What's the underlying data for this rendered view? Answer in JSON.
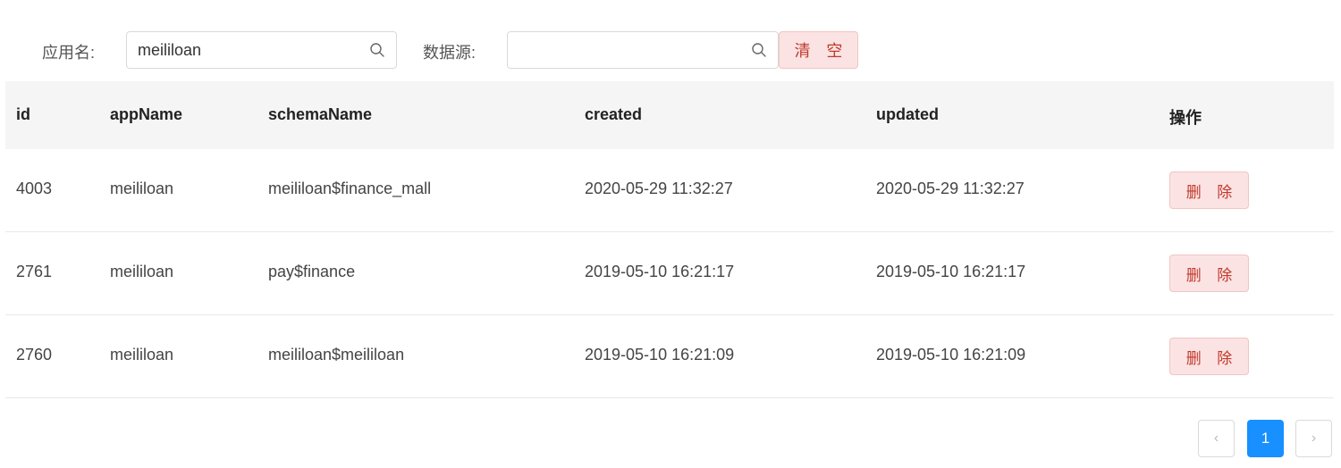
{
  "filters": {
    "app_label": "应用名:",
    "app_value": "meililoan",
    "app_placeholder": "",
    "source_label": "数据源:",
    "source_value": "",
    "source_placeholder": "",
    "clear_label": "清 空"
  },
  "table": {
    "headers": [
      "id",
      "appName",
      "schemaName",
      "created",
      "updated",
      "操作"
    ],
    "rows": [
      {
        "id": "4003",
        "appName": "meililoan",
        "schemaName": "meililoan$finance_mall",
        "created": "2020-05-29 11:32:27",
        "updated": "2020-05-29 11:32:27",
        "action": "删 除"
      },
      {
        "id": "2761",
        "appName": "meililoan",
        "schemaName": "pay$finance",
        "created": "2019-05-10 16:21:17",
        "updated": "2019-05-10 16:21:17",
        "action": "删 除"
      },
      {
        "id": "2760",
        "appName": "meililoan",
        "schemaName": "meililoan$meililoan",
        "created": "2019-05-10 16:21:09",
        "updated": "2019-05-10 16:21:09",
        "action": "删 除"
      }
    ]
  },
  "pagination": {
    "prev": "‹",
    "current": "1",
    "next": "›"
  },
  "colors": {
    "primary": "#1890ff",
    "danger_text": "#c0392b",
    "danger_bg": "#fbe3e3",
    "header_bg": "#f5f5f5"
  }
}
